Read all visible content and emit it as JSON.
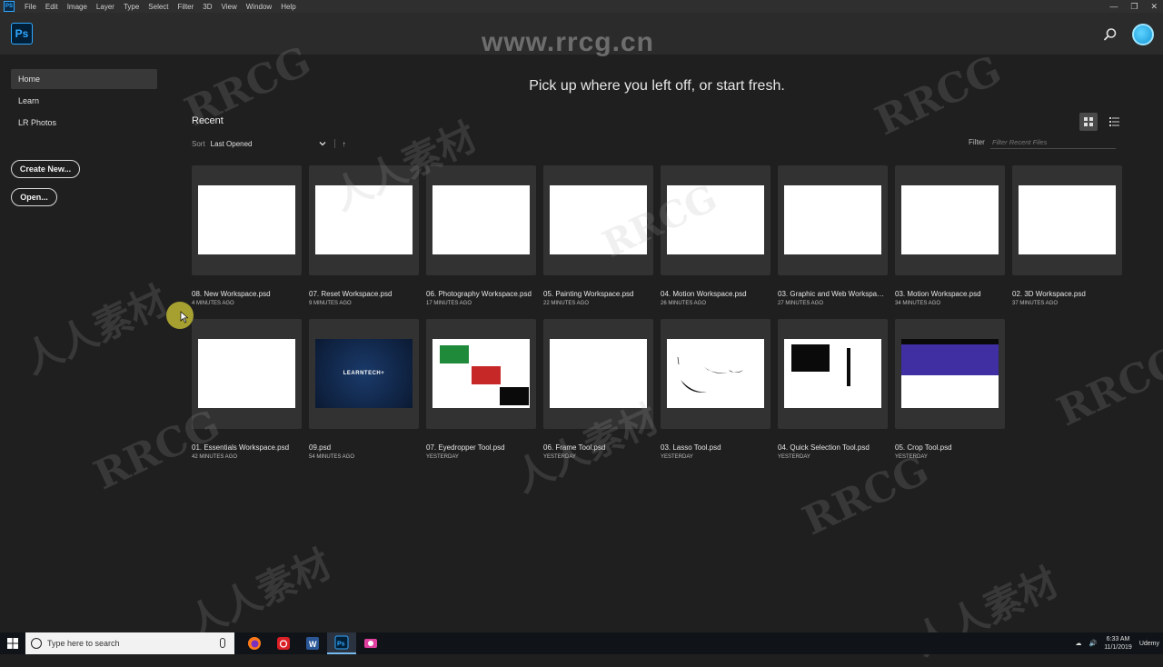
{
  "menubar": {
    "app_icon": "PS",
    "items": [
      "File",
      "Edit",
      "Image",
      "Layer",
      "Type",
      "Select",
      "Filter",
      "3D",
      "View",
      "Window",
      "Help"
    ]
  },
  "header": {
    "logo": "Ps",
    "search_icon": "search-icon",
    "watermark_url": "www.rrcg.cn"
  },
  "sidebar": {
    "items": [
      {
        "label": "Home",
        "active": true
      },
      {
        "label": "Learn",
        "active": false
      },
      {
        "label": "LR Photos",
        "active": false
      }
    ],
    "create_new": "Create New...",
    "open": "Open..."
  },
  "main": {
    "tagline": "Pick up where you left off, or start fresh.",
    "recent_title": "Recent",
    "sort_label": "Sort",
    "sort_value": "Last Opened",
    "sort_direction": "↑",
    "filter_label": "Filter",
    "filter_placeholder": "Filter Recent Files"
  },
  "files": [
    {
      "name": "08. New Workspace.psd",
      "time": "4 MINUTES AGO",
      "thumb": "blank"
    },
    {
      "name": "07. Reset Workspace.psd",
      "time": "9 MINUTES AGO",
      "thumb": "blank"
    },
    {
      "name": "06. Photography Workspace.psd",
      "time": "17 MINUTES AGO",
      "thumb": "blank"
    },
    {
      "name": "05. Painting Workspace.psd",
      "time": "22 MINUTES AGO",
      "thumb": "blank"
    },
    {
      "name": "04. Motion Workspace.psd",
      "time": "26 MINUTES AGO",
      "thumb": "blank"
    },
    {
      "name": "03. Graphic and Web Workspace.psd",
      "time": "27 MINUTES AGO",
      "thumb": "blank"
    },
    {
      "name": "03. Motion Workspace.psd",
      "time": "34 MINUTES AGO",
      "thumb": "blank"
    },
    {
      "name": "02. 3D Workspace.psd",
      "time": "37 MINUTES AGO",
      "thumb": "blank"
    },
    {
      "name": "01. Essentials Workspace.psd",
      "time": "42 MINUTES AGO",
      "thumb": "blank"
    },
    {
      "name": "09.psd",
      "time": "54 MINUTES AGO",
      "thumb": "learntech",
      "thumb_text": "LEARNTECH+"
    },
    {
      "name": "07. Eyedropper Tool.psd",
      "time": "YESTERDAY",
      "thumb": "eyedropper"
    },
    {
      "name": "06. Frame Tool.psd",
      "time": "YESTERDAY",
      "thumb": "blank"
    },
    {
      "name": "03. Lasso Tool.psd",
      "time": "YESTERDAY",
      "thumb": "lasso"
    },
    {
      "name": "04. Quick Selection Tool.psd",
      "time": "YESTERDAY",
      "thumb": "quickselect"
    },
    {
      "name": "05. Crop Tool.psd",
      "time": "YESTERDAY",
      "thumb": "crop"
    }
  ],
  "taskbar": {
    "search_placeholder": "Type here to search",
    "apps": [
      "firefox-icon",
      "creative-cloud-icon",
      "word-icon",
      "photoshop-icon",
      "camera-icon"
    ],
    "clock_time": "6:33 AM",
    "clock_date": "11/1/2019",
    "tray_label": "Udemy"
  },
  "watermarks": [
    "RRCG",
    "人人素材",
    "人人素材"
  ],
  "colors": {
    "accent": "#31a8ff",
    "background": "#1f1f1f",
    "card": "#323232"
  }
}
